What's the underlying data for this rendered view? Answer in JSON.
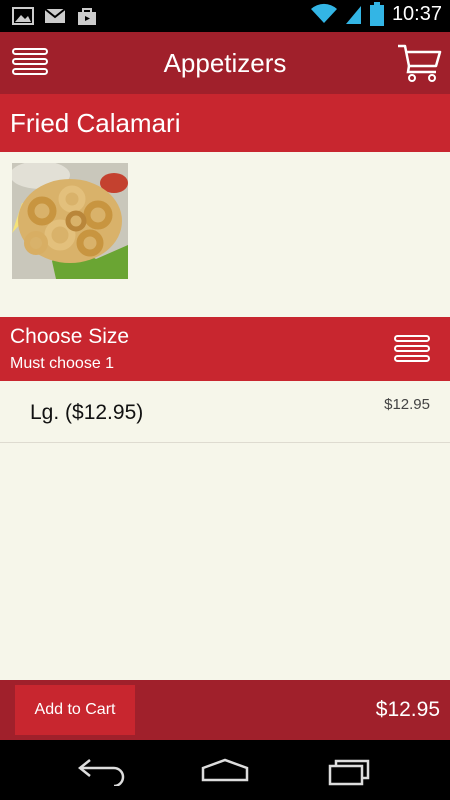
{
  "status_bar": {
    "time": "10:37",
    "icons": [
      "gallery-icon",
      "gmail-icon",
      "shop-icon",
      "wifi-icon",
      "signal-icon",
      "battery-icon"
    ]
  },
  "action_bar": {
    "title": "Appetizers",
    "menu_icon": "menu-icon",
    "cart_icon": "cart-icon"
  },
  "item": {
    "name": "Fried Calamari",
    "image_icon": "fried-calamari-photo"
  },
  "options_section": {
    "title": "Choose Size",
    "subtitle": "Must choose 1",
    "menu_icon": "list-icon",
    "options": [
      {
        "label": "Lg. ($12.95)",
        "price": "$12.95"
      }
    ]
  },
  "bottom_bar": {
    "add_to_cart_label": "Add to Cart",
    "total": "$12.95"
  },
  "nav_bar": {
    "icons": [
      "back-icon",
      "home-icon",
      "recent-apps-icon"
    ]
  },
  "colors": {
    "dark_red": "#a0202b",
    "red": "#c8262f",
    "background": "#f6f6ea"
  }
}
